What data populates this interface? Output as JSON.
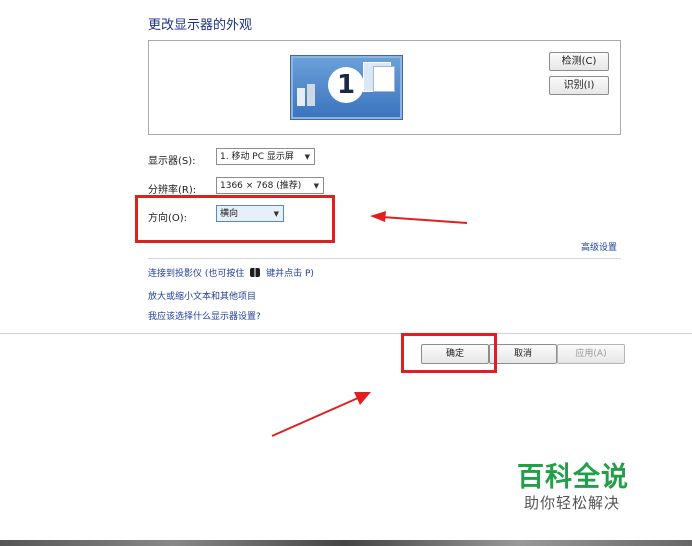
{
  "title": "更改显示器的外观",
  "preview": {
    "monitor_number": "1",
    "detect_button": "检测(C)",
    "identify_button": "识别(I)"
  },
  "settings": {
    "display_label": "显示器(S):",
    "display_value": "1. 移动 PC 显示屏",
    "resolution_label": "分辨率(R):",
    "resolution_value": "1366 × 768 (推荐)",
    "orientation_label": "方向(O):",
    "orientation_value": "横向"
  },
  "advanced_link": "高级设置",
  "links": {
    "projector": "连接到投影仪 (也可按住",
    "projector_suffix": "键并点击 P)",
    "text_size": "放大或缩小文本和其他项目",
    "which_settings": "我应该选择什么显示器设置?"
  },
  "footer": {
    "ok": "确定",
    "cancel": "取消",
    "apply": "应用(A)"
  },
  "watermark": {
    "main": "百科全说",
    "sub": "助你轻松解决"
  },
  "colors": {
    "annotation_red": "#e02020",
    "link_blue": "#1e3fa0",
    "watermark_green": "#22a049"
  }
}
